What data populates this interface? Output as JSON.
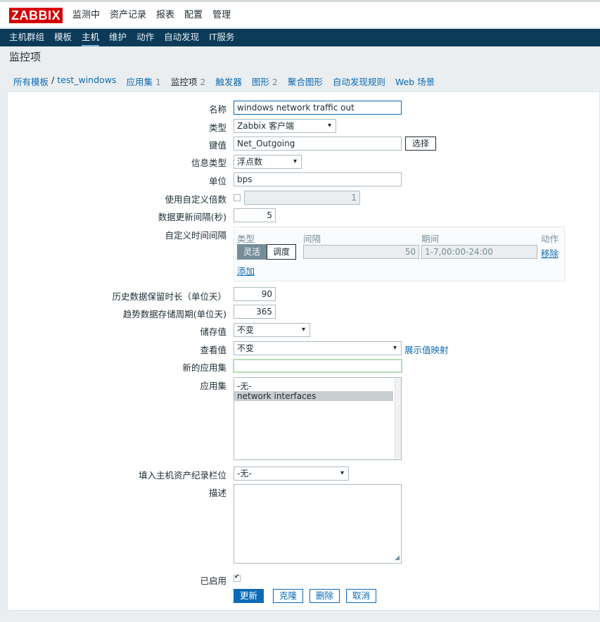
{
  "logo": "ZABBIX",
  "main_menu": [
    "监测中",
    "资产记录",
    "报表",
    "配置",
    "管理"
  ],
  "sub_menu": [
    "主机群组",
    "模板",
    "主机",
    "维护",
    "动作",
    "自动发现",
    "IT服务"
  ],
  "page_title": "监控项",
  "breadcrumb": {
    "all_templates": "所有模板",
    "separator": "/",
    "template": "test_windows",
    "apps": "应用集",
    "apps_count": "1",
    "items": "监控项",
    "items_count": "2",
    "triggers": "触发器",
    "graphs": "图形",
    "graphs_count": "2",
    "screens": "聚合图形",
    "discovery": "自动发现规则",
    "web": "Web 场景"
  },
  "form": {
    "name_label": "名称",
    "name_value": "windows network traffic out",
    "type_label": "类型",
    "type_value": "Zabbix 客户端",
    "key_label": "键值",
    "key_value": "Net_Outgoing",
    "select_button": "选择",
    "info_type_label": "信息类型",
    "info_type_value": "浮点数",
    "units_label": "单位",
    "units_value": "bps",
    "multiplier_label": "使用自定义倍数",
    "multiplier_value": "1",
    "interval_label": "数据更新间隔(秒)",
    "interval_value": "5",
    "custom_intervals_label": "自定义时间间隔",
    "ci_type_header": "类型",
    "ci_interval_header": "间隔",
    "ci_period_header": "期间",
    "ci_action_header": "动作",
    "ci_flexible": "灵活",
    "ci_scheduling": "调度",
    "ci_interval_value": "50",
    "ci_period_value": "1-7,00:00-24:00",
    "ci_remove": "移除",
    "ci_add": "添加",
    "history_label": "历史数据保留时长（单位天）",
    "history_value": "90",
    "trends_label": "趋势数据存储周期(单位天)",
    "trends_value": "365",
    "store_label": "储存值",
    "store_value": "不变",
    "show_label": "查看值",
    "show_value": "不变",
    "show_mapping_link": "展示值映射",
    "new_app_label": "新的应用集",
    "new_app_value": "",
    "apps_label": "应用集",
    "apps_options": [
      "-无-",
      "network interfaces"
    ],
    "inventory_label": "填入主机资产纪录栏位",
    "inventory_value": "-无-",
    "desc_label": "描述",
    "enabled_label": "已启用"
  },
  "actions": {
    "update": "更新",
    "clone": "克隆",
    "delete": "删除",
    "cancel": "取消"
  }
}
